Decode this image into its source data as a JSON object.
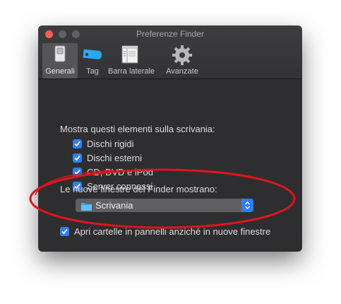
{
  "window": {
    "title": "Preferenze Finder"
  },
  "toolbar": {
    "tabs": [
      {
        "label": "Generali",
        "icon": "switch-icon",
        "selected": true
      },
      {
        "label": "Tag",
        "icon": "tag-icon",
        "selected": false
      },
      {
        "label": "Barra laterale",
        "icon": "sidebar-icon",
        "selected": false
      },
      {
        "label": "Avanzate",
        "icon": "gear-icon",
        "selected": false
      }
    ]
  },
  "desktop_section": {
    "heading": "Mostra questi elementi sulla scrivania:",
    "items": [
      {
        "label": "Dischi rigidi",
        "checked": true
      },
      {
        "label": "Dischi esterni",
        "checked": true
      },
      {
        "label": "CD, DVD e iPod",
        "checked": true
      },
      {
        "label": "Server connessi",
        "checked": true
      }
    ]
  },
  "new_window": {
    "heading": "Le nuove finestre del Finder mostrano:",
    "selected_value": "Scrivania",
    "selected_icon": "folder-icon"
  },
  "open_folders": {
    "label": "Apri cartelle in pannelli anziché in nuove finestre",
    "checked": true
  },
  "colors": {
    "accent": "#2f7df6",
    "annotation": "#e0141e",
    "window_bg": "#2e2e30"
  }
}
